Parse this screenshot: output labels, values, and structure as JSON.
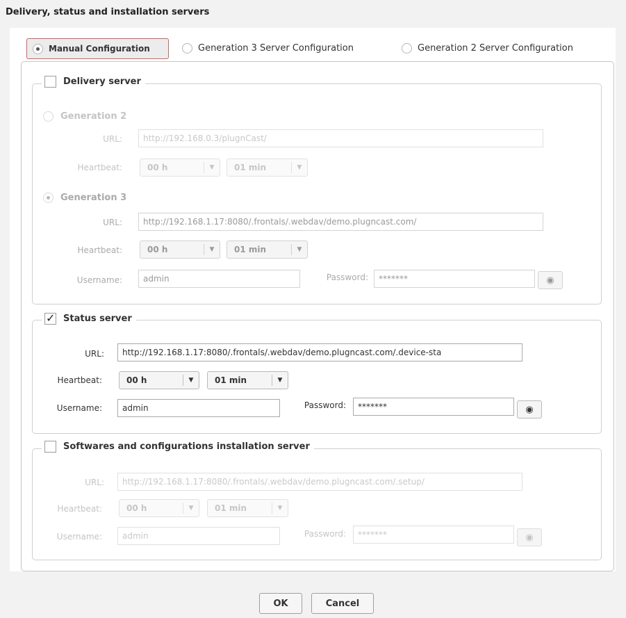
{
  "dialog": {
    "title": "Delivery, status and installation servers"
  },
  "modes": [
    {
      "label": "Manual Configuration",
      "selected": true
    },
    {
      "label": "Generation 3 Server Configuration",
      "selected": false
    },
    {
      "label": "Generation 2 Server Configuration",
      "selected": false
    }
  ],
  "delivery": {
    "legend": "Delivery server",
    "checked": false,
    "gen2": {
      "label": "Generation 2",
      "selected": false,
      "url_label": "URL:",
      "url": "http://192.168.0.3/plugnCast/",
      "heartbeat_label": "Heartbeat:",
      "hours": "00 h",
      "minutes": "01 min"
    },
    "gen3": {
      "label": "Generation 3",
      "selected": true,
      "url_label": "URL:",
      "url": "http://192.168.1.17:8080/.frontals/.webdav/demo.plugncast.com/",
      "heartbeat_label": "Heartbeat:",
      "hours": "00 h",
      "minutes": "01 min",
      "username_label": "Username:",
      "username": "admin",
      "password_label": "Password:",
      "password": "*******"
    }
  },
  "status": {
    "legend": "Status server",
    "checked": true,
    "url_label": "URL:",
    "url": "http://192.168.1.17:8080/.frontals/.webdav/demo.plugncast.com/.device-sta",
    "heartbeat_label": "Heartbeat:",
    "hours": "00 h",
    "minutes": "01 min",
    "username_label": "Username:",
    "username": "admin",
    "password_label": "Password:",
    "password": "*******"
  },
  "install": {
    "legend": "Softwares and configurations installation server",
    "checked": false,
    "url_label": "URL:",
    "url": "http://192.168.1.17:8080/.frontals/.webdav/demo.plugncast.com/.setup/",
    "heartbeat_label": "Heartbeat:",
    "hours": "00 h",
    "minutes": "01 min",
    "username_label": "Username:",
    "username": "admin",
    "password_label": "Password:",
    "password": "*******"
  },
  "footer": {
    "ok_label": "OK",
    "cancel_label": "Cancel"
  },
  "icons": {
    "arrow": "dropdown-arrow-icon",
    "eye": "eye-slash-icon"
  },
  "colors": {
    "selected_border": "#e05c5c",
    "background": "#f2f2f2"
  }
}
